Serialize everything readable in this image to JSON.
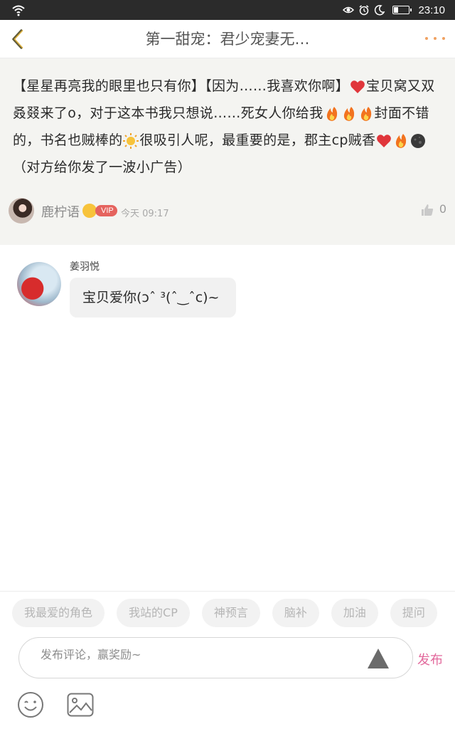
{
  "status_bar": {
    "time": "23:10",
    "icons": [
      "wifi-icon",
      "eye-icon",
      "alarm-icon",
      "moon-icon",
      "battery-icon"
    ]
  },
  "header": {
    "title": "第一甜宠：君少宠妻无…",
    "accent_color": "#f0a160"
  },
  "post": {
    "segments": [
      {
        "type": "text",
        "text": "【星星再亮我的眼里也只有你】【因为……我喜欢你啊】"
      },
      {
        "type": "emoji",
        "icon": "heart-emoji"
      },
      {
        "type": "text",
        "text": "宝贝窝又双叒叕来了o，对于这本书我只想说……死女人你给我"
      },
      {
        "type": "emoji",
        "icon": "fire-emoji"
      },
      {
        "type": "emoji",
        "icon": "fire-emoji"
      },
      {
        "type": "emoji",
        "icon": "fire-emoji"
      },
      {
        "type": "text",
        "text": "封面不错的，书名也贼棒的"
      },
      {
        "type": "emoji",
        "icon": "sun-emoji"
      },
      {
        "type": "text",
        "text": "很吸引人呢，最重要的是，郡主cp贼香"
      },
      {
        "type": "emoji",
        "icon": "heart-emoji"
      },
      {
        "type": "emoji",
        "icon": "fire-emoji"
      },
      {
        "type": "emoji",
        "icon": "dark-moon-emoji"
      },
      {
        "type": "text",
        "text": "（对方给你发了一波小广告）"
      }
    ],
    "author": {
      "name": "鹿柠语",
      "vip_label": "VIP",
      "time": "今天 09:17"
    },
    "likes": "0"
  },
  "reply": {
    "name": "姜羽悦",
    "text": "宝贝爱你(ɔˆ ³(ˆ‿ˆc)~"
  },
  "bottom": {
    "tags": [
      "我最爱的角色",
      "我站的CP",
      "神预言",
      "脑补",
      "加油",
      "提问"
    ],
    "comment_placeholder": "发布评论，赢奖励~",
    "publish_label": "发布",
    "publish_color": "#e2699c"
  }
}
